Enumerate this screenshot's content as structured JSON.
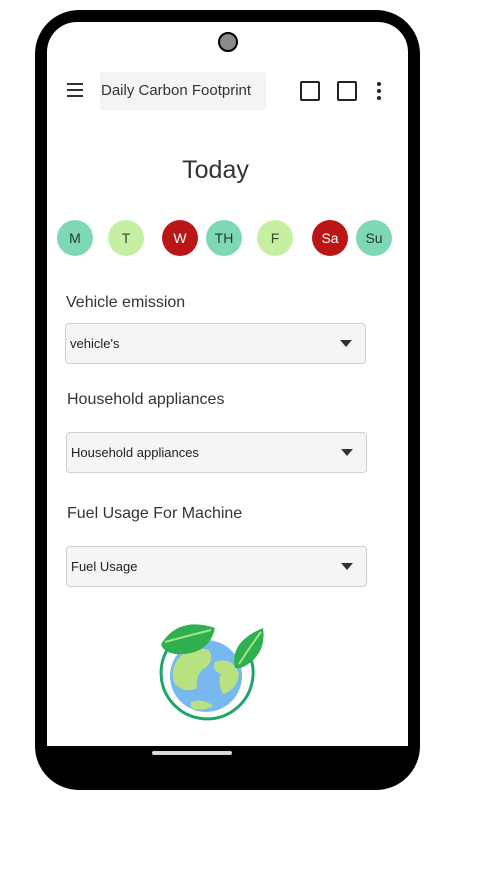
{
  "appbar": {
    "title": "Daily Carbon Footprint",
    "menu_icon": "hamburger-icon",
    "action_icons": [
      "square-icon",
      "square-icon",
      "more-vert-icon"
    ]
  },
  "heading": "Today",
  "days": [
    {
      "label": "M",
      "color": "#7ed8b3"
    },
    {
      "label": "T",
      "color": "#c5f0a4"
    },
    {
      "label": "W",
      "color": "#bb1616"
    },
    {
      "label": "TH",
      "color": "#7ed8b3"
    },
    {
      "label": "F",
      "color": "#c5f0a4"
    },
    {
      "label": "Sa",
      "color": "#bb1616"
    },
    {
      "label": "Su",
      "color": "#7ed8b3"
    }
  ],
  "vehicle": {
    "label": "Vehicle emission",
    "selected": "vehicle's"
  },
  "household": {
    "label": "Household appliances",
    "selected": "Household appliances"
  },
  "fuel": {
    "label": "Fuel Usage For Machine",
    "selected": "Fuel Usage"
  },
  "illustration": "earth-with-leaves-icon"
}
